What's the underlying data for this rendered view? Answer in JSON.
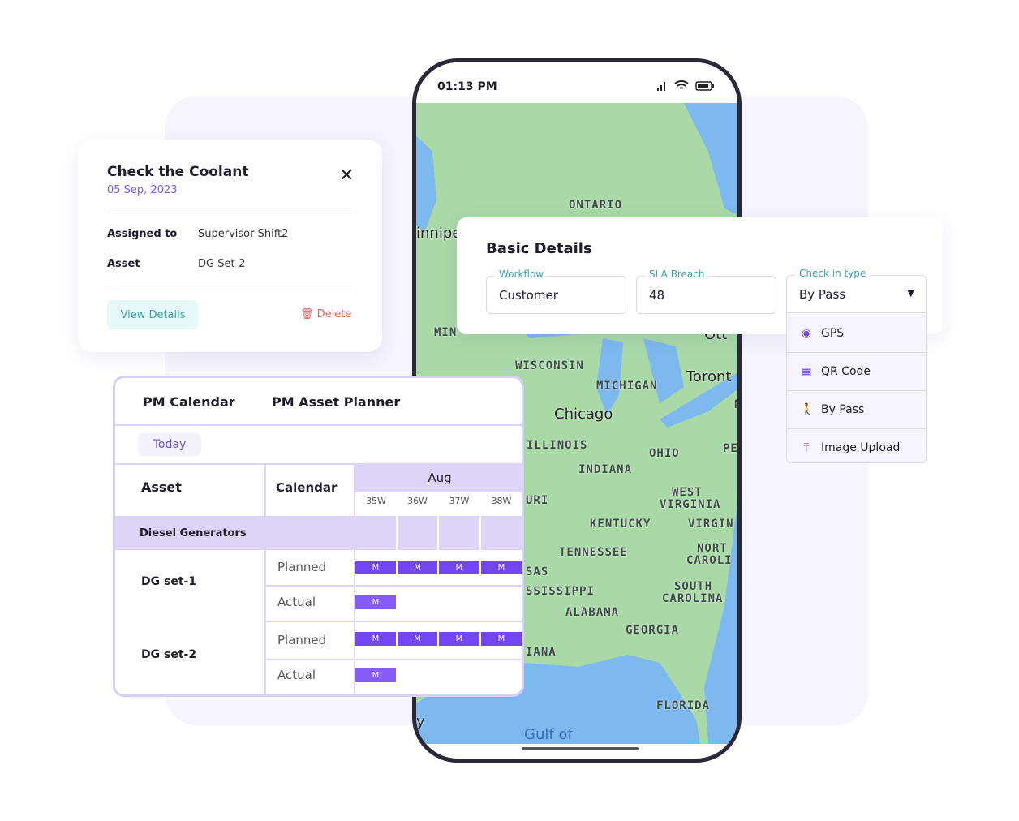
{
  "phone": {
    "time": "01:13 PM",
    "icons": [
      "signal-icon",
      "wifi-icon",
      "battery-icon"
    ]
  },
  "map": {
    "labels": {
      "ontario": "ONTARIO",
      "winnipeg": "innipe",
      "minnesota": "MIN",
      "wisconsin": "WISCONSIN",
      "michigan": "MICHIGAN",
      "toronto": "Toront",
      "chicago": "Chicago",
      "illinois": "ILLINOIS",
      "ohio": "OHIO",
      "indiana": "INDIANA",
      "penn": "PE",
      "wv1": "WEST",
      "wv2": "VIRGINIA",
      "kentucky": "KENTUCKY",
      "virginia": "VIRGIN",
      "tennessee": "TENNESSEE",
      "nc1": "NORT",
      "nc2": "CAROLI",
      "sc1": "SOUTH",
      "sc2": "CAROLINA",
      "mississippi": "SSISSIPPI",
      "alabama": "ALABAMA",
      "georgia": "GEORGIA",
      "florida": "FLORIDA",
      "gulf": "Gulf of",
      "missouri": "URI",
      "arkansas": "SAS",
      "louisiana": "IANA",
      "new_york": "N",
      "ottawa": "Ott",
      "y": "y"
    },
    "colors": {
      "land": "#a8d9a6",
      "water": "#7db8ee"
    }
  },
  "task_card": {
    "title": "Check the Coolant",
    "date": "05 Sep, 2023",
    "assigned_label": "Assigned to",
    "assigned_value": "Supervisor Shift2",
    "asset_label": "Asset",
    "asset_value": "DG Set-2",
    "view_button": "View Details",
    "delete_button": "Delete"
  },
  "pm": {
    "tabs": [
      "PM Calendar",
      "PM Asset Planner"
    ],
    "today": "Today",
    "col_asset": "Asset",
    "col_calendar": "Calendar",
    "month": "Aug",
    "weeks": [
      "35W",
      "36W",
      "37W",
      "38W"
    ],
    "group": "Diesel Generators",
    "assets": [
      {
        "name": "DG set-1",
        "planned": "Planned",
        "actual": "Actual",
        "planned_marks": [
          "M",
          "M",
          "M",
          "M"
        ],
        "actual_marks": [
          "M"
        ]
      },
      {
        "name": "DG set-2",
        "planned": "Planned",
        "actual": "Actual",
        "planned_marks": [
          "M",
          "M",
          "M",
          "M"
        ],
        "actual_marks": [
          "M"
        ]
      }
    ]
  },
  "basic": {
    "title": "Basic Details",
    "workflow_label": "Workflow",
    "workflow_value": "Customer",
    "sla_label": "SLA Breach",
    "sla_value": "48",
    "checkin_label": "Check in type",
    "checkin_value": "By Pass",
    "options": [
      {
        "label": "GPS",
        "icon": "gps-icon"
      },
      {
        "label": "QR Code",
        "icon": "qr-code-icon"
      },
      {
        "label": "By Pass",
        "icon": "walking-person-icon"
      },
      {
        "label": "Image Upload",
        "icon": "upload-icon"
      }
    ]
  }
}
